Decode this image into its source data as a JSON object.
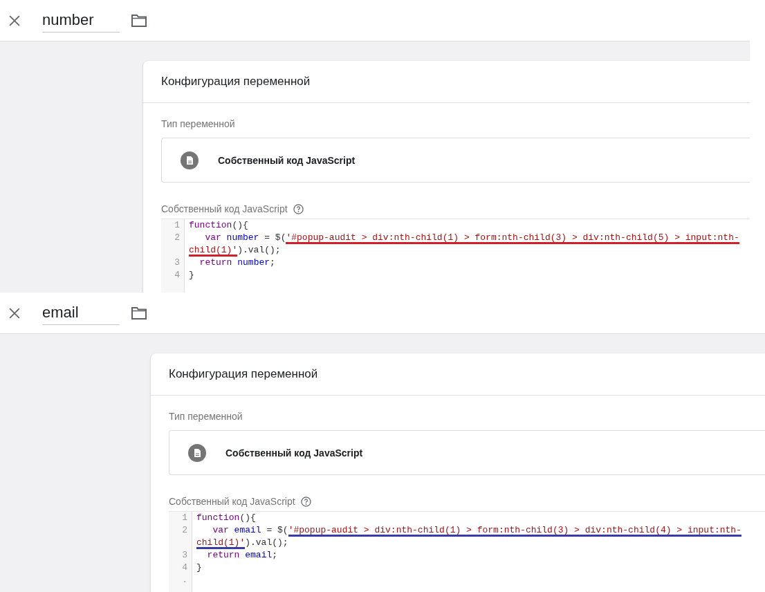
{
  "panels": [
    {
      "name_value": "number",
      "color": "#d0202a",
      "card": {
        "title": "Конфигурация переменной",
        "type_label": "Тип переменной",
        "type_value": "Собственный код JavaScript",
        "code_label": "Собственный код JavaScript",
        "code_lines": [
          {
            "number": "1",
            "visual_rows": [
              {
                "tokens": [
                  {
                    "kind": "keyword",
                    "text": "function"
                  },
                  {
                    "kind": "plain",
                    "text": "(){"
                  }
                ]
              }
            ]
          },
          {
            "number": "2",
            "visual_rows": [
              {
                "tokens": [
                  {
                    "kind": "keyword",
                    "text": "   var"
                  },
                  {
                    "kind": "variable",
                    "text": " number"
                  },
                  {
                    "kind": "plain",
                    "text": " = $("
                  },
                  {
                    "kind": "string",
                    "text": "'#popup-audit > div:nth-child(1) > form:nth-child(3) > div:nth-child(5) > input:nth-",
                    "underlined": true
                  }
                ]
              },
              {
                "tokens": [
                  {
                    "kind": "string",
                    "text": "child(1)'",
                    "underlined": true
                  },
                  {
                    "kind": "plain",
                    "text": ").val();"
                  }
                ]
              }
            ]
          },
          {
            "number": "3",
            "visual_rows": [
              {
                "tokens": [
                  {
                    "kind": "keyword",
                    "text": "  return"
                  },
                  {
                    "kind": "variable",
                    "text": " number"
                  },
                  {
                    "kind": "plain",
                    "text": ";"
                  }
                ]
              }
            ]
          },
          {
            "number": "4",
            "visual_rows": [
              {
                "tokens": [
                  {
                    "kind": "plain",
                    "text": "}"
                  }
                ]
              }
            ]
          }
        ]
      }
    },
    {
      "name_value": "email",
      "color": "#3a3aa8",
      "card": {
        "title": "Конфигурация переменной",
        "type_label": "Тип переменной",
        "type_value": "Собственный код JavaScript",
        "code_label": "Собственный код JavaScript",
        "code_lines": [
          {
            "number": "1",
            "visual_rows": [
              {
                "tokens": [
                  {
                    "kind": "keyword",
                    "text": "function"
                  },
                  {
                    "kind": "plain",
                    "text": "(){"
                  }
                ]
              }
            ]
          },
          {
            "number": "2",
            "visual_rows": [
              {
                "tokens": [
                  {
                    "kind": "keyword",
                    "text": "   var"
                  },
                  {
                    "kind": "variable",
                    "text": " email"
                  },
                  {
                    "kind": "plain",
                    "text": " = $("
                  },
                  {
                    "kind": "string",
                    "text": "'#popup-audit > div:nth-child(1) > form:nth-child(3) > div:nth-child(4) > input:nth-",
                    "underlined": true
                  }
                ]
              },
              {
                "tokens": [
                  {
                    "kind": "string",
                    "text": "child(1)'",
                    "underlined": true
                  },
                  {
                    "kind": "plain",
                    "text": ").val();"
                  }
                ]
              }
            ]
          },
          {
            "number": "3",
            "visual_rows": [
              {
                "tokens": [
                  {
                    "kind": "keyword",
                    "text": "  return"
                  },
                  {
                    "kind": "variable",
                    "text": " email"
                  },
                  {
                    "kind": "plain",
                    "text": ";"
                  }
                ]
              }
            ]
          },
          {
            "number": "4",
            "visual_rows": [
              {
                "tokens": [
                  {
                    "kind": "plain",
                    "text": "}"
                  }
                ]
              }
            ]
          },
          {
            "number": "."
          }
        ]
      }
    }
  ]
}
